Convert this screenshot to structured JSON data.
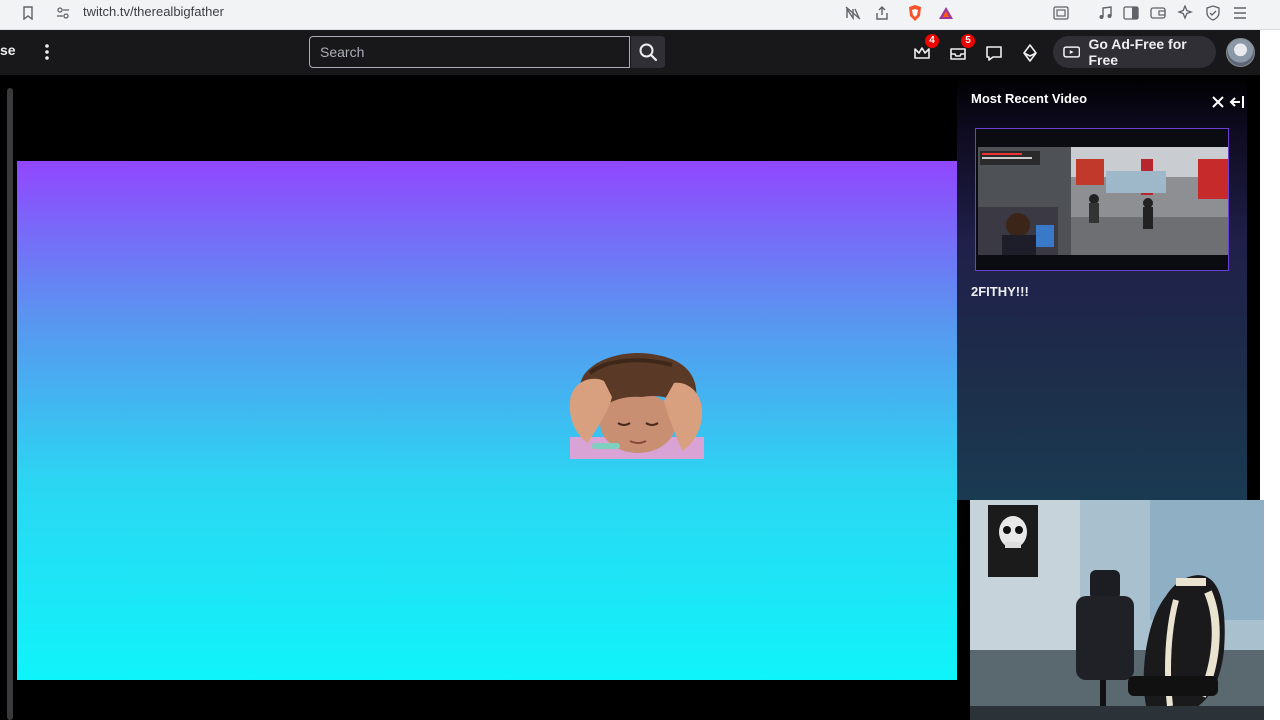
{
  "browser": {
    "url": "twitch.tv/therealbigfather"
  },
  "nav": {
    "left_fragment": "se",
    "search_placeholder": "Search",
    "prime_badge": "4",
    "inbox_badge": "5",
    "ad_free_label": "Go Ad-Free for Free"
  },
  "panel": {
    "title": "Most Recent Video",
    "video_title": "2FITHY!!!"
  },
  "colors": {
    "twitch_purple": "#9147ff",
    "nav_bg": "#18181b",
    "badge_red": "#eb0400",
    "player_top": "#9147ff",
    "player_bottom": "#0ff4fb"
  }
}
